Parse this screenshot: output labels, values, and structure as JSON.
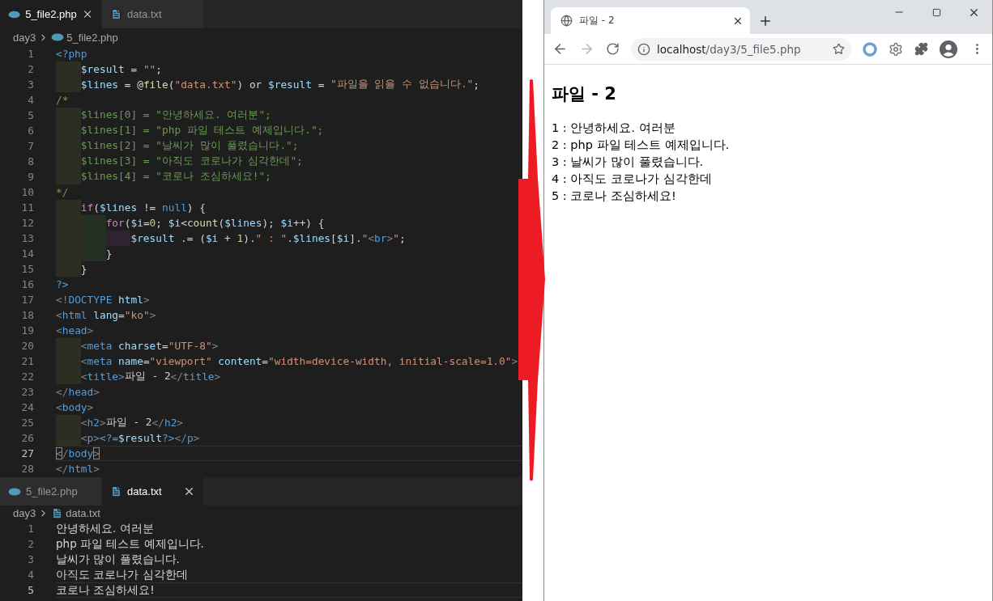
{
  "editors": [
    {
      "tabs": [
        {
          "kind": "php",
          "label": "5_file2.php",
          "selected": true
        },
        {
          "kind": "text",
          "label": "data.txt",
          "selected": false
        }
      ],
      "breadcrumb": {
        "folder": "day3",
        "kind": "php",
        "file": "5_file2.php"
      },
      "lines": [
        {
          "number": "1",
          "current": false,
          "tokens": [
            {
              "kind": "kw",
              "text": "<?php"
            }
          ]
        },
        {
          "number": "2",
          "current": false,
          "tokens": [
            {
              "kind": "indent"
            },
            {
              "kind": "var",
              "text": "$result"
            },
            {
              "kind": "plain",
              "text": " = "
            },
            {
              "kind": "str",
              "text": "\"\""
            },
            {
              "kind": "plain",
              "text": ";"
            }
          ]
        },
        {
          "number": "3",
          "current": false,
          "tokens": [
            {
              "kind": "indent"
            },
            {
              "kind": "var",
              "text": "$lines"
            },
            {
              "kind": "plain",
              "text": " = @"
            },
            {
              "kind": "fn",
              "text": "file"
            },
            {
              "kind": "plain",
              "text": "("
            },
            {
              "kind": "str",
              "text": "\"data.txt\""
            },
            {
              "kind": "plain",
              "text": ") or "
            },
            {
              "kind": "var",
              "text": "$result"
            },
            {
              "kind": "plain",
              "text": " = "
            },
            {
              "kind": "str",
              "text": "\"파일을 읽을 수 없습니다.\""
            },
            {
              "kind": "plain",
              "text": ";"
            }
          ]
        },
        {
          "number": "4",
          "current": false,
          "tokens": [
            {
              "kind": "cmt",
              "text": "/*"
            }
          ]
        },
        {
          "number": "5",
          "current": false,
          "tokens": [
            {
              "kind": "indent"
            },
            {
              "kind": "cmt",
              "text": "$lines[0] = \"안녕하세요. 여러분\";"
            }
          ]
        },
        {
          "number": "6",
          "current": false,
          "tokens": [
            {
              "kind": "indent"
            },
            {
              "kind": "cmt",
              "text": "$lines[1] = \"php 파일 테스트 예제입니다.\";"
            }
          ]
        },
        {
          "number": "7",
          "current": false,
          "tokens": [
            {
              "kind": "indent"
            },
            {
              "kind": "cmt",
              "text": "$lines[2] = \"날씨가 많이 풀렸습니다.\";"
            }
          ]
        },
        {
          "number": "8",
          "current": false,
          "tokens": [
            {
              "kind": "indent"
            },
            {
              "kind": "cmt",
              "text": "$lines[3] = \"아직도 코로나가 심각한데\";"
            }
          ]
        },
        {
          "number": "9",
          "current": false,
          "tokens": [
            {
              "kind": "indent"
            },
            {
              "kind": "cmt",
              "text": "$lines[4] = \"코로나 조심하세요!\";"
            }
          ]
        },
        {
          "number": "10",
          "current": false,
          "tokens": [
            {
              "kind": "cmt",
              "text": "*/"
            }
          ]
        },
        {
          "number": "11",
          "current": false,
          "tokens": [
            {
              "kind": "indent"
            },
            {
              "kind": "ctrl",
              "text": "if"
            },
            {
              "kind": "plain",
              "text": "("
            },
            {
              "kind": "var",
              "text": "$lines"
            },
            {
              "kind": "plain",
              "text": " != "
            },
            {
              "kind": "kw",
              "text": "null"
            },
            {
              "kind": "plain",
              "text": ") {"
            }
          ]
        },
        {
          "number": "12",
          "current": false,
          "tokens": [
            {
              "kind": "indent"
            },
            {
              "kind": "indent"
            },
            {
              "kind": "ctrl",
              "text": "for"
            },
            {
              "kind": "plain",
              "text": "("
            },
            {
              "kind": "var",
              "text": "$i"
            },
            {
              "kind": "plain",
              "text": "="
            },
            {
              "kind": "num",
              "text": "0"
            },
            {
              "kind": "plain",
              "text": "; "
            },
            {
              "kind": "var",
              "text": "$i"
            },
            {
              "kind": "plain",
              "text": "<"
            },
            {
              "kind": "fn",
              "text": "count"
            },
            {
              "kind": "plain",
              "text": "("
            },
            {
              "kind": "var",
              "text": "$lines"
            },
            {
              "kind": "plain",
              "text": "); "
            },
            {
              "kind": "var",
              "text": "$i"
            },
            {
              "kind": "plain",
              "text": "++) {"
            }
          ]
        },
        {
          "number": "13",
          "current": false,
          "tokens": [
            {
              "kind": "indent"
            },
            {
              "kind": "indent"
            },
            {
              "kind": "indent"
            },
            {
              "kind": "var",
              "text": "$result"
            },
            {
              "kind": "plain",
              "text": " .= ("
            },
            {
              "kind": "var",
              "text": "$i"
            },
            {
              "kind": "plain",
              "text": " + "
            },
            {
              "kind": "num",
              "text": "1"
            },
            {
              "kind": "plain",
              "text": ")."
            },
            {
              "kind": "str",
              "text": "\" : \""
            },
            {
              "kind": "plain",
              "text": "."
            },
            {
              "kind": "var",
              "text": "$lines"
            },
            {
              "kind": "plain",
              "text": "["
            },
            {
              "kind": "var",
              "text": "$i"
            },
            {
              "kind": "plain",
              "text": "]."
            },
            {
              "kind": "str",
              "text": "\""
            },
            {
              "kind": "punct",
              "text": "<"
            },
            {
              "kind": "kw",
              "text": "br"
            },
            {
              "kind": "punct",
              "text": ">"
            },
            {
              "kind": "str",
              "text": "\""
            },
            {
              "kind": "plain",
              "text": ";"
            }
          ]
        },
        {
          "number": "14",
          "current": false,
          "tokens": [
            {
              "kind": "indent"
            },
            {
              "kind": "indent"
            },
            {
              "kind": "plain",
              "text": "}"
            }
          ]
        },
        {
          "number": "15",
          "current": false,
          "tokens": [
            {
              "kind": "indent"
            },
            {
              "kind": "plain",
              "text": "}"
            }
          ]
        },
        {
          "number": "16",
          "current": false,
          "tokens": [
            {
              "kind": "kw",
              "text": "?>"
            }
          ]
        },
        {
          "number": "17",
          "current": false,
          "tokens": [
            {
              "kind": "punct",
              "text": "<!"
            },
            {
              "kind": "kw",
              "text": "DOCTYPE"
            },
            {
              "kind": "attr",
              "text": " html"
            },
            {
              "kind": "punct",
              "text": ">"
            }
          ]
        },
        {
          "number": "18",
          "current": false,
          "tokens": [
            {
              "kind": "punct",
              "text": "<"
            },
            {
              "kind": "kw",
              "text": "html"
            },
            {
              "kind": "attr",
              "text": " lang"
            },
            {
              "kind": "plain",
              "text": "="
            },
            {
              "kind": "str",
              "text": "\"ko\""
            },
            {
              "kind": "punct",
              "text": ">"
            }
          ]
        },
        {
          "number": "19",
          "current": false,
          "tokens": [
            {
              "kind": "punct",
              "text": "<"
            },
            {
              "kind": "kw",
              "text": "head"
            },
            {
              "kind": "punct",
              "text": ">"
            }
          ]
        },
        {
          "number": "20",
          "current": false,
          "tokens": [
            {
              "kind": "indent"
            },
            {
              "kind": "punct",
              "text": "<"
            },
            {
              "kind": "kw",
              "text": "meta"
            },
            {
              "kind": "attr",
              "text": " charset"
            },
            {
              "kind": "plain",
              "text": "="
            },
            {
              "kind": "str",
              "text": "\"UTF-8\""
            },
            {
              "kind": "punct",
              "text": ">"
            }
          ]
        },
        {
          "number": "21",
          "current": false,
          "tokens": [
            {
              "kind": "indent"
            },
            {
              "kind": "punct",
              "text": "<"
            },
            {
              "kind": "kw",
              "text": "meta"
            },
            {
              "kind": "attr",
              "text": " name"
            },
            {
              "kind": "plain",
              "text": "="
            },
            {
              "kind": "str",
              "text": "\"viewport\""
            },
            {
              "kind": "attr",
              "text": " content"
            },
            {
              "kind": "plain",
              "text": "="
            },
            {
              "kind": "str",
              "text": "\"width=device-width, initial-scale=1.0\""
            },
            {
              "kind": "punct",
              "text": ">"
            }
          ]
        },
        {
          "number": "22",
          "current": false,
          "tokens": [
            {
              "kind": "indent"
            },
            {
              "kind": "punct",
              "text": "<"
            },
            {
              "kind": "kw",
              "text": "title"
            },
            {
              "kind": "punct",
              "text": ">"
            },
            {
              "kind": "plain",
              "text": "파일 - 2"
            },
            {
              "kind": "punct",
              "text": "</"
            },
            {
              "kind": "kw",
              "text": "title"
            },
            {
              "kind": "punct",
              "text": ">"
            }
          ]
        },
        {
          "number": "23",
          "current": false,
          "tokens": [
            {
              "kind": "punct",
              "text": "</"
            },
            {
              "kind": "kw",
              "text": "head"
            },
            {
              "kind": "punct",
              "text": ">"
            }
          ]
        },
        {
          "number": "24",
          "current": false,
          "tokens": [
            {
              "kind": "punct",
              "text": "<"
            },
            {
              "kind": "kw",
              "text": "body"
            },
            {
              "kind": "punct",
              "text": ">"
            }
          ]
        },
        {
          "number": "25",
          "current": false,
          "tokens": [
            {
              "kind": "indent"
            },
            {
              "kind": "punct",
              "text": "<"
            },
            {
              "kind": "kw",
              "text": "h2"
            },
            {
              "kind": "punct",
              "text": ">"
            },
            {
              "kind": "plain",
              "text": "파일 - 2"
            },
            {
              "kind": "punct",
              "text": "</"
            },
            {
              "kind": "kw",
              "text": "h2"
            },
            {
              "kind": "punct",
              "text": ">"
            }
          ]
        },
        {
          "number": "26",
          "current": false,
          "tokens": [
            {
              "kind": "indent"
            },
            {
              "kind": "punct",
              "text": "<"
            },
            {
              "kind": "kw",
              "text": "p"
            },
            {
              "kind": "punct",
              "text": ">"
            },
            {
              "kind": "kw",
              "text": "<?="
            },
            {
              "kind": "var",
              "text": "$result"
            },
            {
              "kind": "kw",
              "text": "?>"
            },
            {
              "kind": "punct",
              "text": "</"
            },
            {
              "kind": "kw",
              "text": "p"
            },
            {
              "kind": "punct",
              "text": ">"
            }
          ]
        },
        {
          "number": "27",
          "current": true,
          "tokens": [
            {
              "kind": "match",
              "text": "<"
            },
            {
              "kind": "punct",
              "text": "/"
            },
            {
              "kind": "kw",
              "text": "body"
            },
            {
              "kind": "match",
              "text": ">"
            }
          ]
        },
        {
          "number": "28",
          "current": false,
          "tokens": [
            {
              "kind": "punct",
              "text": "</"
            },
            {
              "kind": "kw",
              "text": "html"
            },
            {
              "kind": "punct",
              "text": ">"
            }
          ]
        }
      ]
    },
    {
      "tabs": [
        {
          "kind": "php",
          "label": "5_file2.php",
          "selected": false
        },
        {
          "kind": "text",
          "label": "data.txt",
          "selected": true
        }
      ],
      "breadcrumb": {
        "folder": "day3",
        "kind": "text",
        "file": "data.txt"
      },
      "lines": [
        {
          "number": "1",
          "current": false,
          "tokens": [
            {
              "kind": "plain",
              "text": "안녕하세요. 여러분"
            }
          ]
        },
        {
          "number": "2",
          "current": false,
          "tokens": [
            {
              "kind": "plain",
              "text": "php 파일 테스트 예제입니다."
            }
          ]
        },
        {
          "number": "3",
          "current": false,
          "tokens": [
            {
              "kind": "plain",
              "text": "날씨가 많이 풀렸습니다."
            }
          ]
        },
        {
          "number": "4",
          "current": false,
          "tokens": [
            {
              "kind": "plain",
              "text": "아직도 코로나가 심각한데"
            }
          ]
        },
        {
          "number": "5",
          "current": true,
          "tokens": [
            {
              "kind": "plain",
              "text": "코로나 조심하세요!"
            }
          ]
        }
      ]
    }
  ],
  "browser": {
    "tab": {
      "title": "파일 - 2"
    },
    "nav": [
      {
        "kind": "back",
        "disabled": false
      },
      {
        "kind": "forward",
        "disabled": true
      },
      {
        "kind": "reload",
        "disabled": false
      }
    ],
    "address": {
      "host": "localhost",
      "path": "/day3/5_file5.php"
    },
    "extensions": [
      {
        "kind": "ring"
      },
      {
        "kind": "gear"
      },
      {
        "kind": "puzzle"
      }
    ],
    "page": {
      "heading": "파일 - 2",
      "lines": [
        "1 : 안녕하세요. 여러분",
        "2 : php 파일 테스트 예제입니다.",
        "3 : 날씨가 많이 풀렸습니다.",
        "4 : 아직도 코로나가 심각한데",
        "5 : 코로나 조심하세요!"
      ]
    }
  }
}
